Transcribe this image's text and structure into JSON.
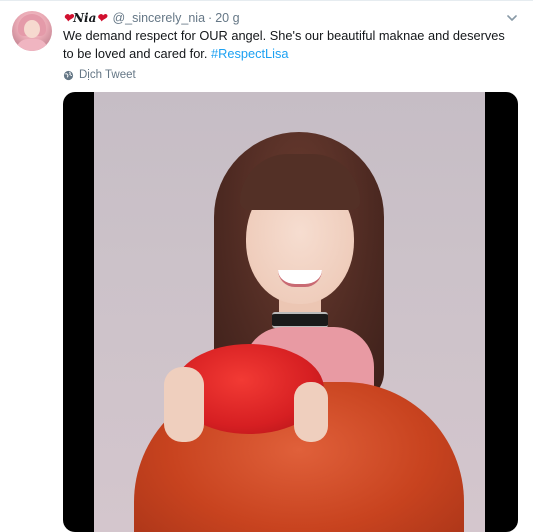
{
  "tweet": {
    "display_name": "Nia",
    "handle": "@_sincerely_nia",
    "separator": "·",
    "time": "20 g",
    "text_main": "We demand respect for OUR angel. She's our beautiful maknae and deserves to be loved and cared for. ",
    "hashtag": "#RespectLisa",
    "translate_label": "Dịch Tweet"
  },
  "icons": {
    "heart": "heart-icon",
    "caret": "chevron-down-icon",
    "globe": "globe-icon"
  },
  "colors": {
    "link": "#1da1f2",
    "secondary_text": "#657786",
    "heart": "#d1102f"
  }
}
